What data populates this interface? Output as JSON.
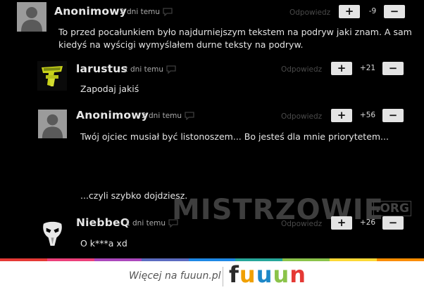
{
  "thread": {
    "comments": [
      {
        "author": "Anonimowy",
        "time": "2 dni temu",
        "reply": "Odpowiedz",
        "plus": "+",
        "minus": "−",
        "score": "-9",
        "body": "To przed pocałunkiem było najdurniejszym tekstem na podryw jaki znam. A sam kiedyś na wyścigi wymyślałem durne teksty na podryw."
      },
      {
        "author": "larustus",
        "time": "2 dni temu",
        "reply": "Odpowiedz",
        "plus": "+",
        "minus": "−",
        "score": "+21",
        "body": "Zapodaj jakiś"
      },
      {
        "author": "Anonimowy",
        "time": "2 dni temu",
        "reply": "Odpowiedz",
        "plus": "+",
        "minus": "−",
        "score": "+56",
        "body_line1": "Twój ojciec musiał być listonoszem... Bo jesteś dla mnie priorytetem...",
        "body_line2": "...czyli szybko dojdziesz."
      },
      {
        "author": "NiebbeQ",
        "time": "1 dni temu",
        "reply": "Odpowiedz",
        "plus": "+",
        "minus": "−",
        "score": "+26",
        "body": "O k***a xd"
      }
    ]
  },
  "watermark": {
    "text": "MISTRZOWIE",
    "suffix": ".ORG"
  },
  "footer": {
    "text": "Więcej na fuuun.pl",
    "logo_letters": [
      "f",
      "u",
      "u",
      "u",
      "n"
    ],
    "logo_colors": [
      "#2b2b2b",
      "#f0a000",
      "#1e88c8",
      "#8bc34a",
      "#e53935"
    ]
  },
  "stripe_colors": [
    "#e53935",
    "#ec407a",
    "#ab47bc",
    "#5c6bc0",
    "#1e88e5",
    "#26a69a",
    "#8bc34a",
    "#fdd835",
    "#fb8c00"
  ],
  "colors": {
    "background": "#000000",
    "author": "#e6e6e6",
    "vote_button": "#e4e4e4"
  },
  "icons": [
    "person-silhouette-icon",
    "flag-icon",
    "team-logo-icon",
    "mask-icon"
  ]
}
